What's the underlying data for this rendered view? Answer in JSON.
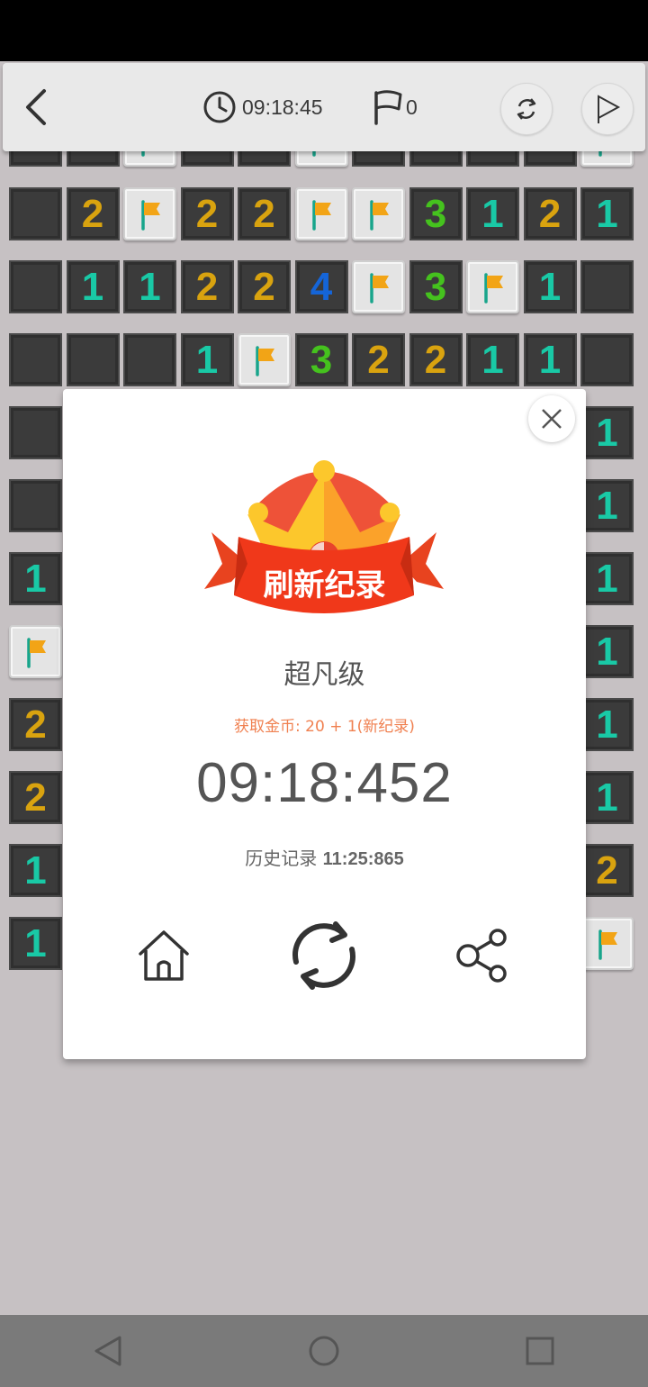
{
  "header": {
    "timer": "09:18:45",
    "flag_count": "0",
    "icons": [
      "back-arrow-icon",
      "clock-icon",
      "flag-icon",
      "refresh-icon",
      "play-icon"
    ]
  },
  "board": {
    "rows": [
      [
        "",
        "",
        "F",
        "",
        "",
        "F",
        "",
        "",
        "",
        "",
        "F"
      ],
      [
        "",
        "2",
        "F",
        "2",
        "2",
        "F",
        "F",
        "3",
        "1",
        "2",
        "1"
      ],
      [
        "",
        "1",
        "1",
        "2",
        "2",
        "4",
        "F",
        "3",
        "F",
        "1",
        ""
      ],
      [
        "",
        "",
        "",
        "1",
        "F",
        "3",
        "2",
        "2",
        "1",
        "1",
        ""
      ],
      [
        "",
        "",
        "",
        "",
        "",
        "",
        "",
        "",
        "",
        "",
        "1"
      ],
      [
        "",
        "",
        "",
        "",
        "",
        "",
        "",
        "",
        "",
        "",
        "1"
      ],
      [
        "1",
        "",
        "",
        "",
        "",
        "",
        "",
        "",
        "",
        "",
        "1"
      ],
      [
        "F",
        "",
        "",
        "",
        "",
        "",
        "",
        "",
        "",
        "",
        "1"
      ],
      [
        "2",
        "",
        "",
        "",
        "",
        "",
        "",
        "",
        "",
        "",
        "1"
      ],
      [
        "2",
        "",
        "",
        "",
        "",
        "",
        "",
        "",
        "",
        "",
        "1"
      ],
      [
        "1",
        "",
        "",
        "",
        "",
        "",
        "",
        "",
        "",
        "",
        "2"
      ],
      [
        "1",
        "",
        "",
        "",
        "",
        "",
        "",
        "",
        "",
        "",
        "F"
      ]
    ],
    "number_colors": {
      "1": "#19c9a6",
      "2": "#d9a30f",
      "3": "#45c21e",
      "4": "#1565d8"
    }
  },
  "dialog": {
    "banner": "刷新纪录",
    "difficulty": "超凡级",
    "coins": "获取金币: 20 + 1(新纪录)",
    "time": "09:18:452",
    "record_label": "历史记录",
    "record_value": "11:25:865",
    "icons": [
      "close-icon",
      "crown-icon",
      "home-icon",
      "replay-icon",
      "share-icon"
    ]
  },
  "navbar": {
    "icons": [
      "nav-back-icon",
      "nav-home-icon",
      "nav-recents-icon"
    ]
  }
}
